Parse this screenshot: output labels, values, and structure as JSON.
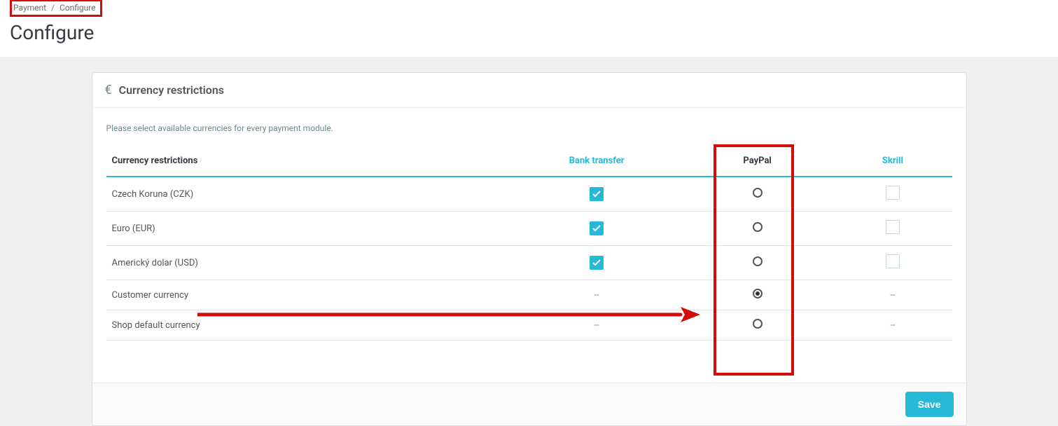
{
  "breadcrumb": {
    "parent": "Payment",
    "current": "Configure"
  },
  "page_title": "Configure",
  "panel": {
    "title": "Currency restrictions",
    "helper": "Please select available currencies for every payment module."
  },
  "columns": {
    "curr_label": "Currency restrictions",
    "bank": "Bank transfer",
    "paypal": "PayPal",
    "skrill": "Skrill"
  },
  "rows": {
    "czk": {
      "label": "Czech Koruna (CZK)",
      "bank_checked": true,
      "paypal_selected": false,
      "skrill_checked": false,
      "skrill_dash": false
    },
    "eur": {
      "label": "Euro (EUR)",
      "bank_checked": true,
      "paypal_selected": false,
      "skrill_checked": false,
      "skrill_dash": false
    },
    "usd": {
      "label": "Americký dolar (USD)",
      "bank_checked": true,
      "paypal_selected": false,
      "skrill_checked": false,
      "skrill_dash": false
    },
    "customer": {
      "label": "Customer currency",
      "bank_dash": "--",
      "paypal_selected": true,
      "skrill_dash": "--"
    },
    "shop": {
      "label": "Shop default currency",
      "bank_dash": "--",
      "paypal_selected": false,
      "skrill_dash": "--"
    }
  },
  "buttons": {
    "save": "Save"
  }
}
